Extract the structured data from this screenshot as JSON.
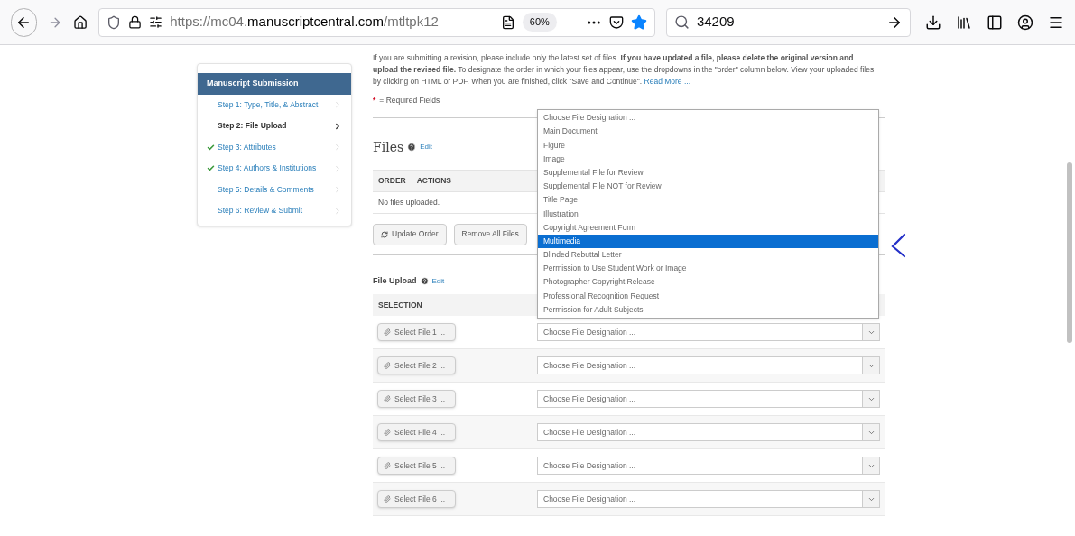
{
  "browser": {
    "url_start": "https://mc04.",
    "url_domain": "manuscriptcentral.com",
    "url_path": "/mtltpk12",
    "zoom": "60%",
    "search": "34209"
  },
  "sidebar": {
    "title": "Manuscript Submission",
    "steps": [
      {
        "label": "Step 1: Type, Title, & Abstract",
        "checked": false,
        "selected": false
      },
      {
        "label": "Step 2: File Upload",
        "checked": false,
        "selected": true
      },
      {
        "label": "Step 3: Attributes",
        "checked": true,
        "selected": false
      },
      {
        "label": "Step 4: Authors & Institutions",
        "checked": true,
        "selected": false
      },
      {
        "label": "Step 5: Details & Comments",
        "checked": false,
        "selected": false
      },
      {
        "label": "Step 6: Review & Submit",
        "checked": false,
        "selected": false
      }
    ]
  },
  "intro": {
    "text": "If you are submitting a revision, please include only the latest set of files. **If you have updated a file, please delete the original version and upload the revised file.** To designate the order in which your files appear, use the dropdowns in the \"order\" column below. View your uploaded files by clicking on HTML or PDF. When you are finished, click \"Save and Continue\".",
    "link": "Read More ..."
  },
  "required": {
    "mark": "*",
    "label": "= Required Fields"
  },
  "files": {
    "title": "Files",
    "edit": "Edit",
    "columns": [
      "ORDER",
      "ACTIONS"
    ],
    "empty": "No files uploaded.",
    "buttons": [
      "Update Order",
      "Remove All Files"
    ]
  },
  "upload": {
    "title": "File Upload",
    "edit": "Edit",
    "column": "SELECTION",
    "rows": [
      {
        "button": "Select File 1 ...",
        "designation": "Choose File Designation ..."
      },
      {
        "button": "Select File 2 ...",
        "designation": "Choose File Designation ..."
      },
      {
        "button": "Select File 3 ...",
        "designation": "Choose File Designation ..."
      },
      {
        "button": "Select File 4 ...",
        "designation": "Choose File Designation ..."
      },
      {
        "button": "Select File 5 ...",
        "designation": "Choose File Designation ..."
      },
      {
        "button": "Select File 6 ...",
        "designation": "Choose File Designation ..."
      }
    ]
  },
  "dropdown": {
    "options": [
      {
        "label": "Choose File Designation ...",
        "selected": false
      },
      {
        "label": "Main Document",
        "selected": false
      },
      {
        "label": "Figure",
        "selected": false
      },
      {
        "label": "Image",
        "selected": false
      },
      {
        "label": "Supplemental File for Review",
        "selected": false
      },
      {
        "label": "Supplemental File NOT for Review",
        "selected": false
      },
      {
        "label": "Title Page",
        "selected": false
      },
      {
        "label": "Illustration",
        "selected": false
      },
      {
        "label": "Copyright Agreement Form",
        "selected": false
      },
      {
        "label": "Multimedia",
        "selected": true
      },
      {
        "label": "Blinded Rebuttal Letter",
        "selected": false
      },
      {
        "label": "Permission to Use Student Work or Image",
        "selected": false
      },
      {
        "label": "Photographer Copyright Release",
        "selected": false
      },
      {
        "label": "Professional Recognition Request",
        "selected": false
      },
      {
        "label": "Permission for Adult Subjects",
        "selected": false
      }
    ]
  }
}
